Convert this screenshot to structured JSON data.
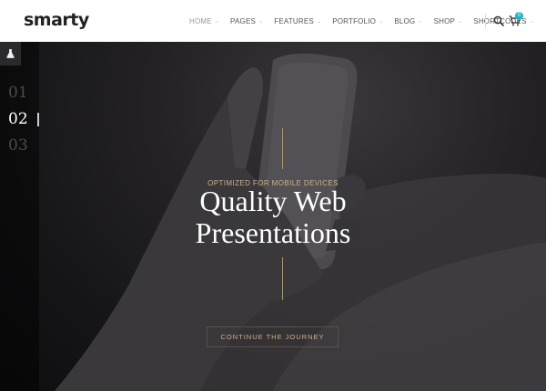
{
  "brand": {
    "logo": "smarty"
  },
  "nav": {
    "items": [
      {
        "label": "HOME",
        "active": true
      },
      {
        "label": "PAGES"
      },
      {
        "label": "FEATURES"
      },
      {
        "label": "PORTFOLIO"
      },
      {
        "label": "BLOG"
      },
      {
        "label": "SHOP"
      },
      {
        "label": "SHORTCODES"
      }
    ],
    "cart_count": "0"
  },
  "slider": {
    "numbers": [
      "01",
      "02",
      "03"
    ],
    "active_index": 1,
    "eyebrow": "OPTIMIZED FOR MOBILE DEVICES",
    "title_line1": "Quality Web",
    "title_line2": "Presentations",
    "cta_label": "CONTINUE THE JOURNEY"
  },
  "colors": {
    "accent_gold": "#c9b48a",
    "cart_badge": "#1fb5c9",
    "header_bg": "#ffffff"
  },
  "icons": [
    "search-icon",
    "cart-icon",
    "flask-icon",
    "chevron-down-icon"
  ]
}
